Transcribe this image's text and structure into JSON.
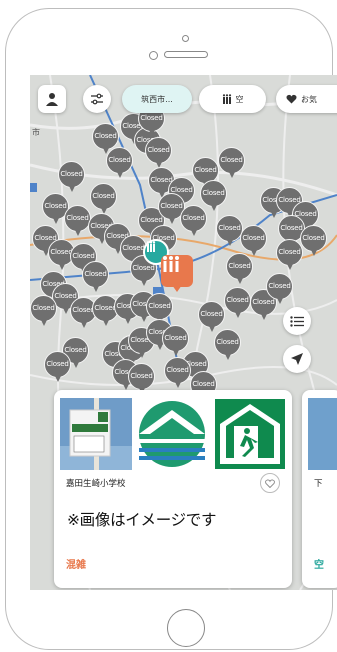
{
  "toolbar": {
    "area_label": "筑西市...",
    "vacancy_label": "空",
    "favorite_label": "お気"
  },
  "map": {
    "pin_label": "Closed",
    "edge_label_left": "市",
    "colors": {
      "pin_gray": "#6f6f6f",
      "shelter_orange": "#e8784c",
      "teal": "#27a9a0",
      "road_blue": "#4f83c9",
      "road_orange": "#e8a86a"
    }
  },
  "card": {
    "name": "嘉田生崎小学校",
    "notice": "※画像はイメージです",
    "status": "混雑",
    "sign_text": "嘉田生崎"
  },
  "card2": {
    "name": "下",
    "status": "空"
  },
  "icons": [
    "user-icon",
    "filter-icon",
    "people-icon",
    "heart-icon",
    "list-icon",
    "locate-icon",
    "shelter-icon",
    "exit-icon"
  ]
}
